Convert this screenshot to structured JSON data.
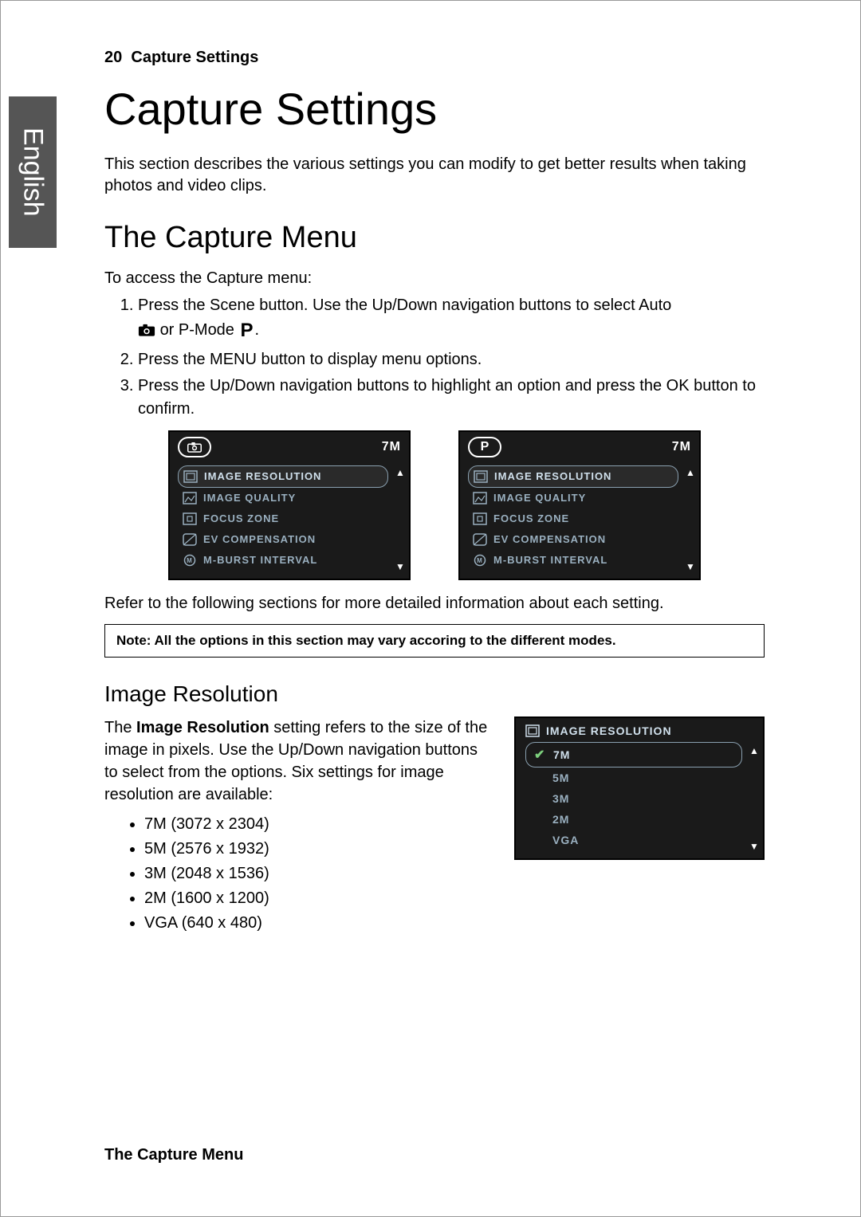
{
  "lang_tab": "English",
  "header": {
    "page_number": "20",
    "page_label": "Capture Settings"
  },
  "title": "Capture Settings",
  "intro": "This section describes the various settings you can modify to get better results when taking photos and video clips.",
  "section_title": "The Capture Menu",
  "access_intro": "To access the Capture menu:",
  "steps": {
    "s1_a": "Press the Scene button. Use the Up/Down navigation buttons to select Auto",
    "s1_b": " or P-Mode ",
    "s1_end": ".",
    "s2": "Press the MENU button to display menu options.",
    "s3": "Press the Up/Down navigation buttons to highlight an option and press the OK button to confirm."
  },
  "menu": {
    "size_badge": "7M",
    "mode_pill_p": "P",
    "items": [
      "IMAGE RESOLUTION",
      "IMAGE QUALITY",
      "FOCUS ZONE",
      "EV COMPENSATION",
      "M-BURST INTERVAL"
    ]
  },
  "refer_line": "Refer to the following sections for more detailed information about each setting.",
  "note": "Note: All the options in this section may vary accoring to the different modes.",
  "sub_title": "Image Resolution",
  "ir_para_a": "The ",
  "ir_para_bold": "Image Resolution",
  "ir_para_b": " setting refers to the size of the image in pixels. Use the Up/Down navigation buttons to select from the options. Six settings for image resolution are available:",
  "resolutions": [
    "7M (3072 x 2304)",
    "5M (2576 x 1932)",
    "3M (2048 x 1536)",
    "2M (1600 x 1200)",
    "VGA (640 x 480)"
  ],
  "ir_screen": {
    "header": "IMAGE RESOLUTION",
    "options": [
      "7M",
      "5M",
      "3M",
      "2M",
      "VGA"
    ]
  },
  "footer": "The Capture Menu"
}
